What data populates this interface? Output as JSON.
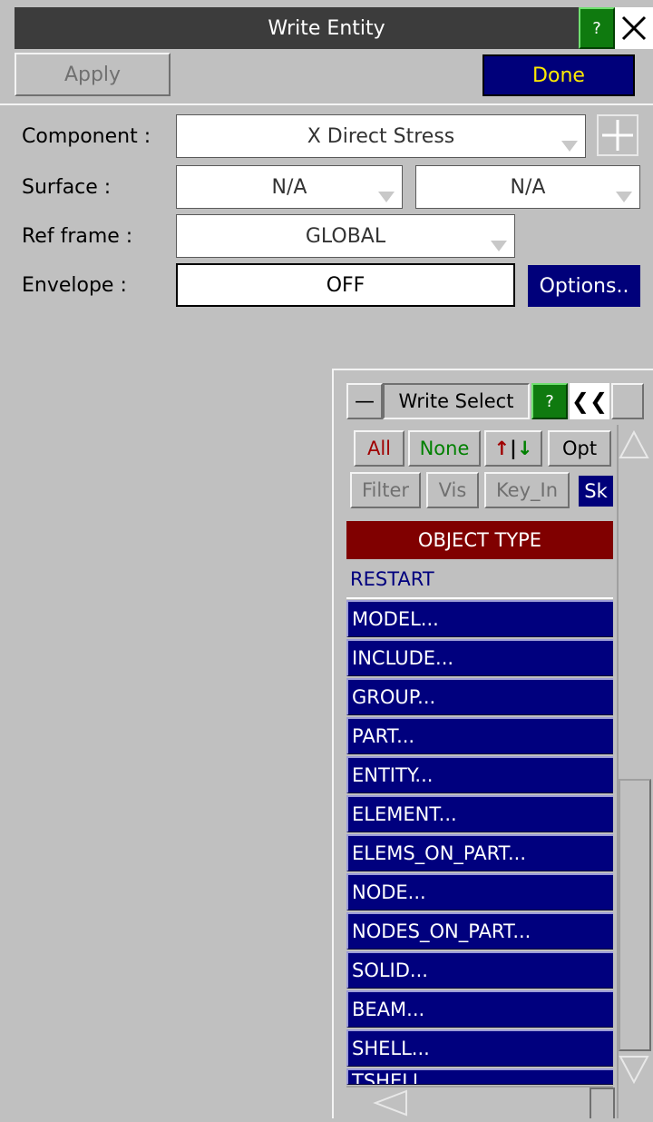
{
  "window": {
    "title": "Write Entity",
    "help": "?",
    "close": "✕"
  },
  "toolbar": {
    "apply": "Apply",
    "done": "Done"
  },
  "form": {
    "component": {
      "label": "Component :",
      "value": "X Direct Stress",
      "add": "+"
    },
    "surface": {
      "label": "Surface :",
      "value1": "N/A",
      "value2": "N/A"
    },
    "ref_frame": {
      "label": "Ref frame :",
      "value": "GLOBAL"
    },
    "envelope": {
      "label": "Envelope :",
      "value": "OFF",
      "options": "Options.."
    }
  },
  "select_panel": {
    "minimize": "—",
    "title": "Write Select",
    "help": "?",
    "collapse": "❮❮",
    "buttons": {
      "all": "All",
      "none": "None",
      "sort": "↑|↓",
      "opt": "Opt"
    },
    "filters": {
      "filter": "Filter",
      "vis": "Vis",
      "key_in": "Key_In",
      "sk": "Sk"
    },
    "header": "OBJECT TYPE",
    "items": [
      "RESTART",
      "MODEL...",
      "INCLUDE...",
      "GROUP...",
      "PART...",
      "ENTITY...",
      "ELEMENT...",
      "ELEMS_ON_PART...",
      "NODE...",
      "NODES_ON_PART...",
      "SOLID...",
      "BEAM...",
      "SHELL...",
      "TSHELL"
    ]
  },
  "colors": {
    "navy": "#00007a",
    "header_red": "#800000",
    "help_green": "#0f7a0f",
    "all_red": "#a00000",
    "none_green": "#008000"
  }
}
